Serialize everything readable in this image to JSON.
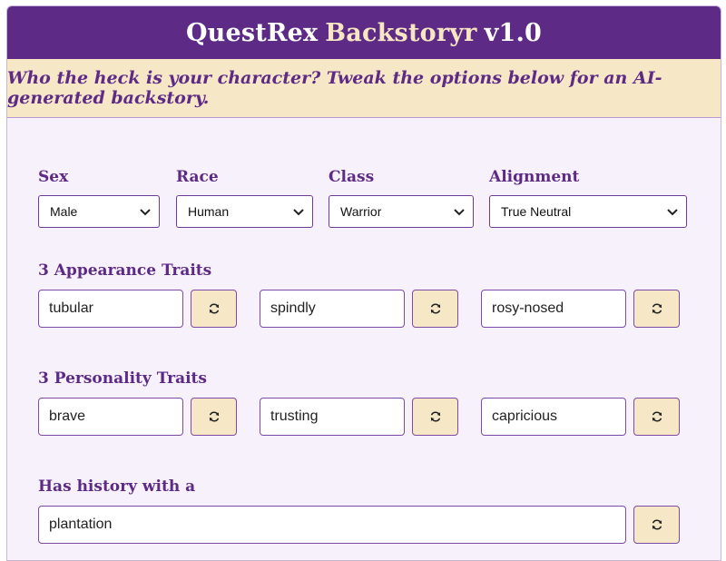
{
  "header": {
    "title_part1": "QuestRex",
    "title_part2": "Backstoryr",
    "title_part3": "v1.0"
  },
  "subtitle": "Who the heck is your character? Tweak the options below for an AI-generated backstory.",
  "selects": {
    "sex": {
      "label": "Sex",
      "value": "Male"
    },
    "race": {
      "label": "Race",
      "value": "Human"
    },
    "class": {
      "label": "Class",
      "value": "Warrior"
    },
    "alignment": {
      "label": "Alignment",
      "value": "True Neutral"
    }
  },
  "appearance": {
    "label": "3 Appearance Traits",
    "traits": [
      "tubular",
      "spindly",
      "rosy-nosed"
    ]
  },
  "personality": {
    "label": "3 Personality Traits",
    "traits": [
      "brave",
      "trusting",
      "capricious"
    ]
  },
  "history": {
    "label": "Has history with a",
    "value": "plantation"
  },
  "icons": {
    "dropdown": "chevron-down-icon",
    "reroll": "refresh-icon"
  },
  "colors": {
    "primary_purple": "#5d2a86",
    "cream": "#f6e8c7",
    "background": "#f6f1fb"
  }
}
